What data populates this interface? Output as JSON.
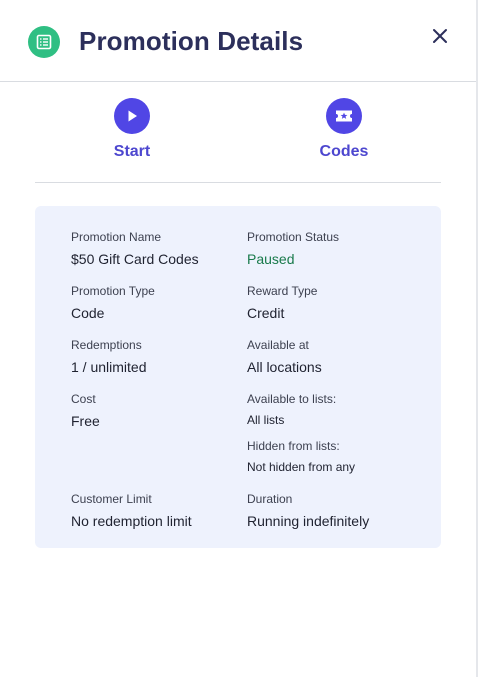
{
  "header": {
    "title": "Promotion Details",
    "icon": "list-icon",
    "icon_color": "#2fbf83"
  },
  "actions": [
    {
      "label": "Start",
      "icon": "play-icon"
    },
    {
      "label": "Codes",
      "icon": "ticket-icon"
    }
  ],
  "accent_color": "#5046e5",
  "details": {
    "promotion_name": {
      "label": "Promotion Name",
      "value": "$50 Gift Card Codes"
    },
    "promotion_status": {
      "label": "Promotion Status",
      "value": "Paused",
      "color": "#197a4b"
    },
    "promotion_type": {
      "label": "Promotion Type",
      "value": "Code"
    },
    "reward_type": {
      "label": "Reward Type",
      "value": "Credit"
    },
    "redemptions": {
      "label": "Redemptions",
      "value": "1 / unlimited"
    },
    "available_at": {
      "label": "Available at",
      "value": "All locations"
    },
    "cost": {
      "label": "Cost",
      "value": "Free"
    },
    "available_to_lists": {
      "label": "Available to lists:",
      "value": "All lists"
    },
    "hidden_from_lists": {
      "label": "Hidden from lists:",
      "value": "Not hidden from any"
    },
    "customer_limit": {
      "label": "Customer Limit",
      "value": "No redemption limit"
    },
    "duration": {
      "label": "Duration",
      "value": "Running indefinitely"
    }
  }
}
